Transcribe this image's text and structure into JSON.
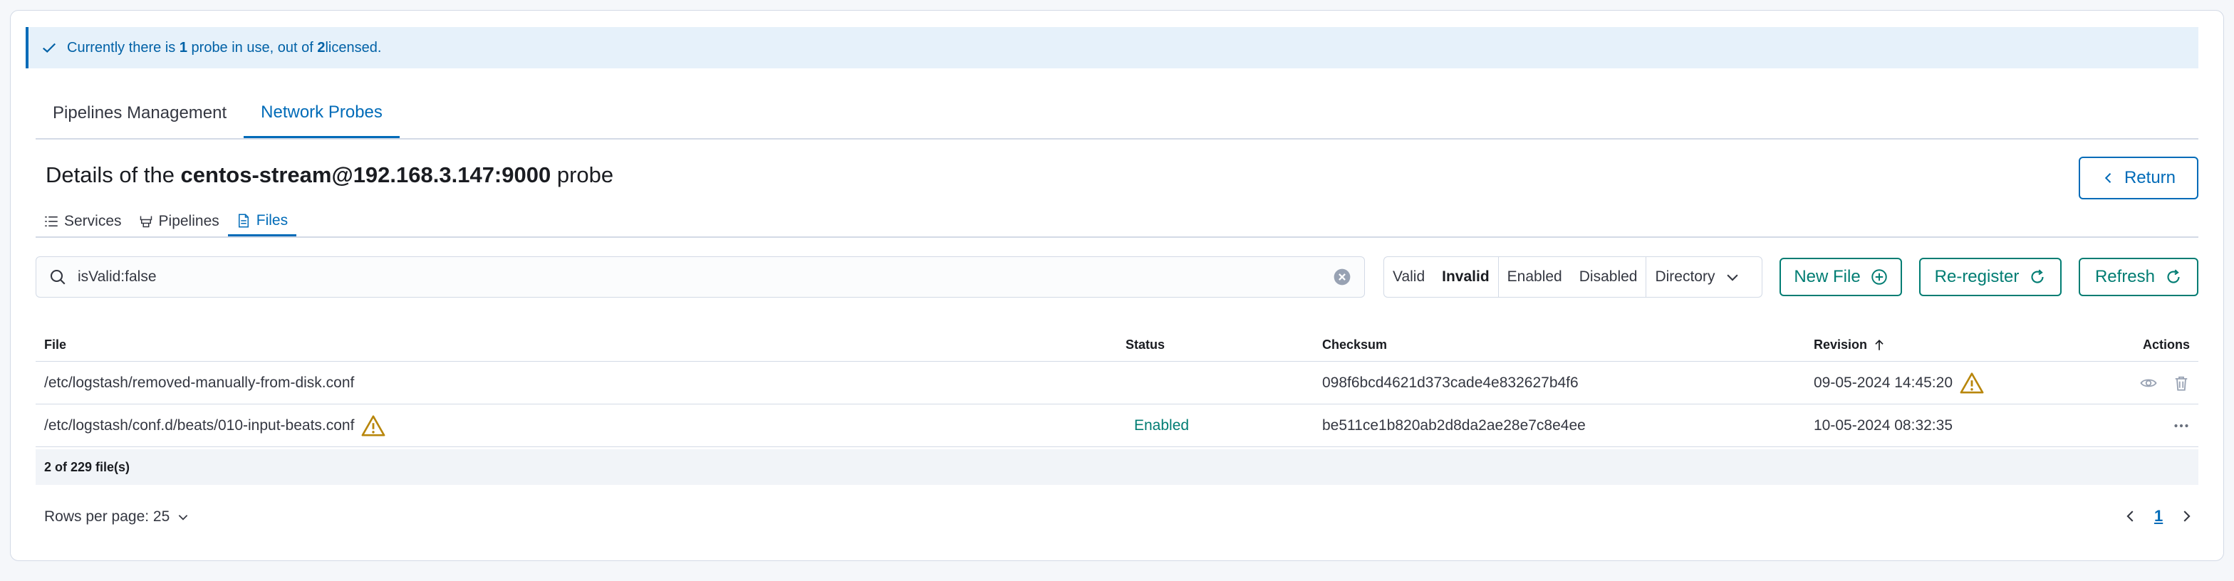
{
  "callout": {
    "prefix": "Currently there is ",
    "count": "1",
    "middle": " probe in use, out of ",
    "total": "2",
    "suffix": " licensed."
  },
  "tabs": [
    {
      "label": "Pipelines Management",
      "active": false
    },
    {
      "label": "Network Probes",
      "active": true
    }
  ],
  "title": {
    "prefix": "Details of the ",
    "probe": "centos-stream@192.168.3.147:9000",
    "suffix": " probe"
  },
  "return_label": "Return",
  "subtabs": [
    {
      "label": "Services",
      "icon": "list-icon"
    },
    {
      "label": "Pipelines",
      "icon": "pipeline-icon"
    },
    {
      "label": "Files",
      "icon": "document-icon",
      "active": true
    }
  ],
  "search": {
    "value": "isValid:false"
  },
  "filters": {
    "valid": "Valid",
    "invalid": "Invalid",
    "enabled": "Enabled",
    "disabled": "Disabled",
    "directory": "Directory"
  },
  "buttons": {
    "new_file": "New File",
    "reregister": "Re-register",
    "refresh": "Refresh"
  },
  "table": {
    "headers": {
      "file": "File",
      "status": "Status",
      "checksum": "Checksum",
      "revision": "Revision",
      "actions": "Actions"
    },
    "rows": [
      {
        "file": "/etc/logstash/removed-manually-from-disk.conf",
        "status": "",
        "checksum": "098f6bcd4621d373cade4e832627b4f6",
        "revision": "09-05-2024 14:45:20"
      },
      {
        "file": "/etc/logstash/conf.d/beats/010-input-beats.conf",
        "status": "Enabled",
        "checksum": "be511ce1b820ab2d8da2ae28e7c8e4ee",
        "revision": "10-05-2024 08:32:35"
      }
    ],
    "count_label": "2 of 229 file(s)"
  },
  "pagination": {
    "rows_per_page": "Rows per page: 25",
    "current_page": "1"
  },
  "colors": {
    "primary": "#006bb8",
    "success": "#017d73",
    "warning": "#b8860b",
    "callout_bg": "#e6f1fa"
  }
}
